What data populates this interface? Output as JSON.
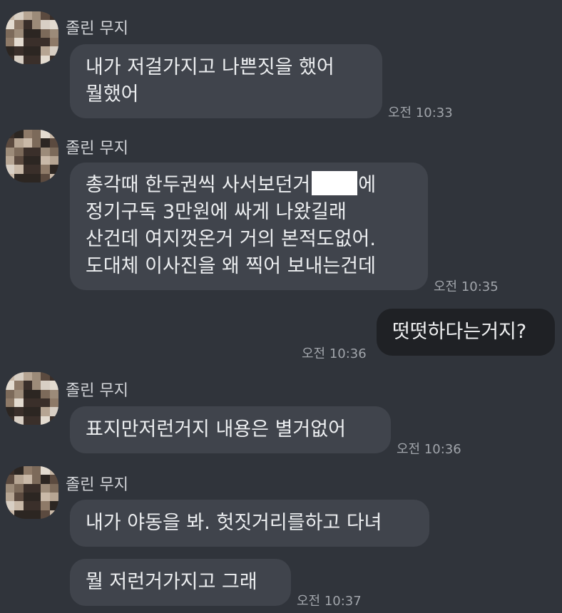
{
  "messages": [
    {
      "sender": "졸린 무지",
      "lines": [
        "내가 저걸가지고 나쁜짓을 했어",
        "뭘했어"
      ],
      "time": "오전 10:33"
    },
    {
      "sender": "졸린 무지",
      "line1_before": "총각때 한두권씩 사서보던거",
      "line1_after": "에",
      "lines_rest": "정기구독 3만원에 싸게 나왔길래\n산건데 여지껏온거 거의 본적도없어.\n도대체 이사진을 왜 찍어 보내는건데",
      "time": "오전 10:35"
    },
    {
      "text": "떳떳하다는거지?",
      "time": "오전 10:36",
      "is_mine": true
    },
    {
      "sender": "졸린 무지",
      "text": "표지만저런거지 내용은 별거없어",
      "time": "오전 10:36"
    },
    {
      "sender": "졸린 무지",
      "text1": "내가 야동을 봐. 헛짓거리를하고 다녀",
      "text2": "뭘 저런거가지고 그래",
      "time": "오전 10:37"
    }
  ],
  "avatar_palette": [
    "#c9b9a8",
    "#8e7a68",
    "#5b4a3f",
    "#d8cfc4",
    "#7c6a5a",
    "#3a2f2a",
    "#b6a593",
    "#e3dbd0",
    "#2c2622",
    "#9c8b79"
  ]
}
